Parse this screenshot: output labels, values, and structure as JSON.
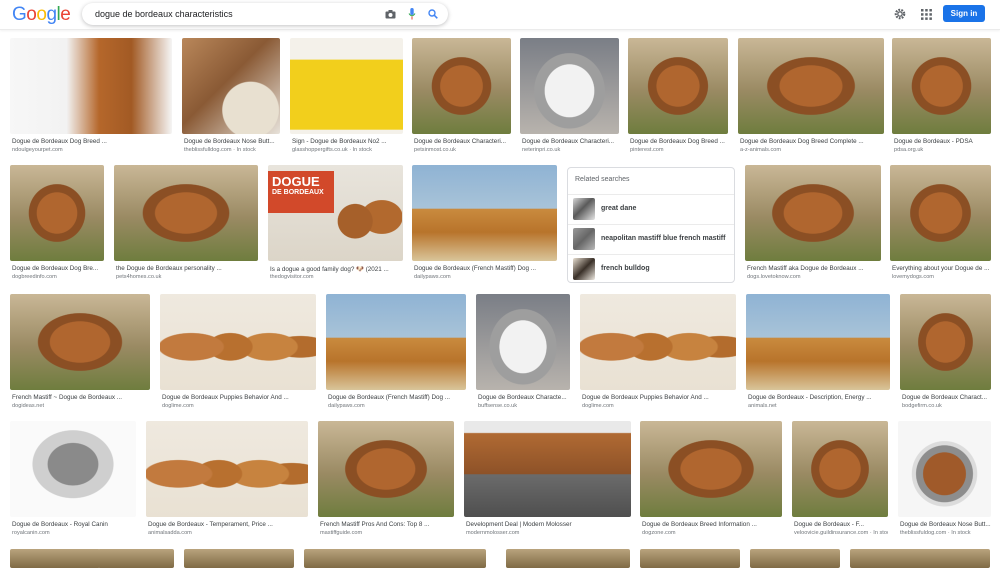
{
  "header": {
    "logo": [
      "G",
      "o",
      "o",
      "g",
      "l",
      "e"
    ],
    "logo_colors": [
      "#4285f4",
      "#ea4335",
      "#fbbc05",
      "#4285f4",
      "#34a853",
      "#ea4335"
    ],
    "query": "dogue de bordeaux characteristics",
    "signin_label": "Sign in"
  },
  "colors": {
    "accent": "#1a73e8"
  },
  "results": [
    {
      "title": "Dogue de Bordeaux Dog Breed ...",
      "source": "ndoulgeyourpet.com",
      "thumb": "chart"
    },
    {
      "title": "Dogue de Bordeaux Nose Butt...",
      "source": "thebliss​fulldog.com · In stock",
      "thumb": "product"
    },
    {
      "title": "Sign - Dogue de Bordeaux No2 ...",
      "source": "glasshoppergifts.co.uk · In stock",
      "thumb": "sign"
    },
    {
      "title": "Dogue de Bordeaux Characteri...",
      "source": "petsinmost.co.uk",
      "thumb": "dog"
    },
    {
      "title": "Dogue de Bordeaux Characteri...",
      "source": "neterinpri.co.uk",
      "thumb": "cat"
    },
    {
      "title": "Dogue de Bordeaux Dog Breed ...",
      "source": "pinterest.com",
      "thumb": "dog"
    },
    {
      "title": "Dogue de Bordeaux Dog Breed Complete ...",
      "source": "a-z-animals.com",
      "thumb": "dog"
    },
    {
      "title": "Dogue de Bordeaux - PDSA",
      "source": "pdsa.org.uk",
      "thumb": "dog"
    },
    {
      "title": "Dogue de Bordeaux Dog Bre...",
      "source": "dogbreedinfo.com",
      "thumb": "dog"
    },
    {
      "title": "the Dogue de Bordeaux personality ...",
      "source": "pets4homes.co.uk",
      "thumb": "dog"
    },
    {
      "title": "Is a dogue a good family dog? 🐶 (2021 ...",
      "source": "thedogvisitor.com",
      "thumb": "dogue"
    },
    {
      "title": "Dogue de Bordeaux (French Mastiff) Dog ...",
      "source": "dailypaws.com",
      "thumb": "dogs"
    },
    {
      "title": "French Mastiff aka Dogue de Bordeaux ...",
      "source": "dogs.lovetoknow.com",
      "thumb": "dog"
    },
    {
      "title": "Everything about your Dogue de ...",
      "source": "lovemydogs.com",
      "thumb": "dog"
    },
    {
      "title": "French Mastiff ~ Dogue de Bordeaux ...",
      "source": "dogideas.net",
      "thumb": "dog"
    },
    {
      "title": "Dogue de Bordeaux Puppies Behavior And ...",
      "source": "doglime.com",
      "thumb": "pups"
    },
    {
      "title": "Dogue de Bordeaux (French Mastiff) Dog ...",
      "source": "dailypaws.com",
      "thumb": "dogs"
    },
    {
      "title": "Dogue de Bordeaux Characte...",
      "source": "buffsense.co.uk",
      "thumb": "cat"
    },
    {
      "title": "Dogue de Bordeaux Puppies Behavior And ...",
      "source": "doglime.com",
      "thumb": "pups"
    },
    {
      "title": "Dogue de Bordeaux - Description, Energy ...",
      "source": "animals.net",
      "thumb": "dogs"
    },
    {
      "title": "Dogue de Bordeaux Charact...",
      "source": "bodgefirm.co.uk",
      "thumb": "dog"
    },
    {
      "title": "Dogue de Bordeaux - Royal Canin",
      "source": "royalcanin.com",
      "thumb": "sketch"
    },
    {
      "title": "Dogue de Bordeaux - Temperament, Price ...",
      "source": "animalsadda.com",
      "thumb": "pups"
    },
    {
      "title": "French Mastiff Pros And Cons: Top 8 ...",
      "source": "mastiffguide.com",
      "thumb": "dog"
    },
    {
      "title": "Development Deal | Modern Molosser",
      "source": "modernmolosser.com",
      "thumb": "row"
    },
    {
      "title": "Dogue de Bordeaux Breed Information ...",
      "source": "dogzone.com",
      "thumb": "dog"
    },
    {
      "title": "Dogue de Bordeaux - F...",
      "source": "veloovicie.guildinsurance.com · In stock",
      "thumb": "dog"
    },
    {
      "title": "Dogue de Bordeaux Nose Butt...",
      "source": "theblissfuldog.com · In stock",
      "thumb": "tin"
    }
  ],
  "related": {
    "heading": "Related searches",
    "items": [
      {
        "label": "great dane"
      },
      {
        "label": "neapolitan mastiff blue french mastiff"
      },
      {
        "label": "french bulldog"
      }
    ]
  },
  "dogue_sign": {
    "line1": "DOGUE",
    "line2": "DE BORDEAUX"
  }
}
